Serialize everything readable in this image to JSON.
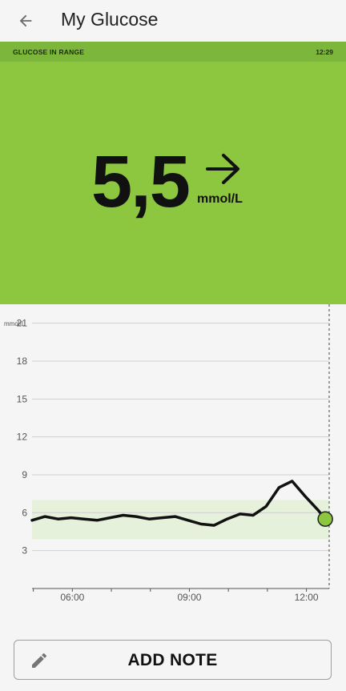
{
  "appbar": {
    "title": "My Glucose",
    "back_icon": "arrow-back-icon"
  },
  "status": {
    "label": "GLUCOSE IN RANGE",
    "time": "12:29"
  },
  "reading": {
    "value": "5,5",
    "unit": "mmol/L",
    "trend_icon": "arrow-right-icon"
  },
  "colors": {
    "in_range_green": "#8dc63f",
    "status_strip": "#7cb73c",
    "target_band": "#e6f1db",
    "line": "#111111",
    "current_point": "#8dc63f"
  },
  "chart_data": {
    "type": "line",
    "ylabel": "mmol/L",
    "ylim": [
      0,
      22.5
    ],
    "yticks": [
      3,
      6,
      9,
      12,
      15,
      18,
      21
    ],
    "ytick_labels": [
      "3",
      "6",
      "9",
      "12",
      "15",
      "18",
      "21"
    ],
    "xlim": [
      "04:58",
      "12:35"
    ],
    "xticks": [
      "06:00",
      "09:00",
      "12:00"
    ],
    "target_range": [
      3.9,
      7.0
    ],
    "grid": true,
    "series": [
      {
        "x": [
          "04:58",
          "05:18",
          "05:38",
          "05:58",
          "06:18",
          "06:38",
          "06:58",
          "07:18",
          "07:38",
          "07:58",
          "08:18",
          "08:38",
          "08:58",
          "09:18",
          "09:38",
          "09:58",
          "10:18",
          "10:38",
          "10:58",
          "11:18",
          "11:38",
          "11:58",
          "12:18",
          "12:29"
        ],
        "y": [
          5.4,
          5.7,
          5.5,
          5.6,
          5.5,
          5.4,
          5.6,
          5.8,
          5.7,
          5.5,
          5.6,
          5.7,
          5.4,
          5.1,
          5.0,
          5.5,
          5.9,
          5.8,
          6.5,
          8.0,
          8.5,
          7.3,
          6.2,
          5.5
        ]
      }
    ],
    "current_value": 5.5,
    "current_time": "12:29"
  },
  "add_note": {
    "label": "ADD NOTE",
    "icon": "pencil-icon"
  }
}
